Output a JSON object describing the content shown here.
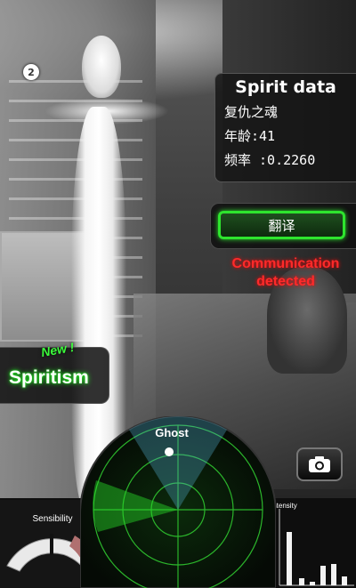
{
  "badge": {
    "value": "2"
  },
  "spirit_panel": {
    "title": "Spirit data",
    "name": "复仇之魂",
    "age": "年龄:41",
    "frequency": "频率 :0.2260"
  },
  "translate_button": {
    "label": "翻译"
  },
  "communication_status": {
    "line1": "Communication",
    "line2": "detected",
    "color": "#ff2a2a"
  },
  "spiritism": {
    "badge": "New !",
    "label": "Spiritism",
    "accent": "#3cff3c"
  },
  "radar": {
    "label": "Ghost",
    "color": "#22ff22"
  },
  "sensibility": {
    "label": "Sensibility",
    "level_fraction": 0.55
  },
  "intensity": {
    "label": "Intensity",
    "bars": [
      0.85,
      0.1,
      0.05,
      0.28,
      0.3,
      0.12
    ]
  },
  "icons": {
    "camera": "camera-icon"
  }
}
